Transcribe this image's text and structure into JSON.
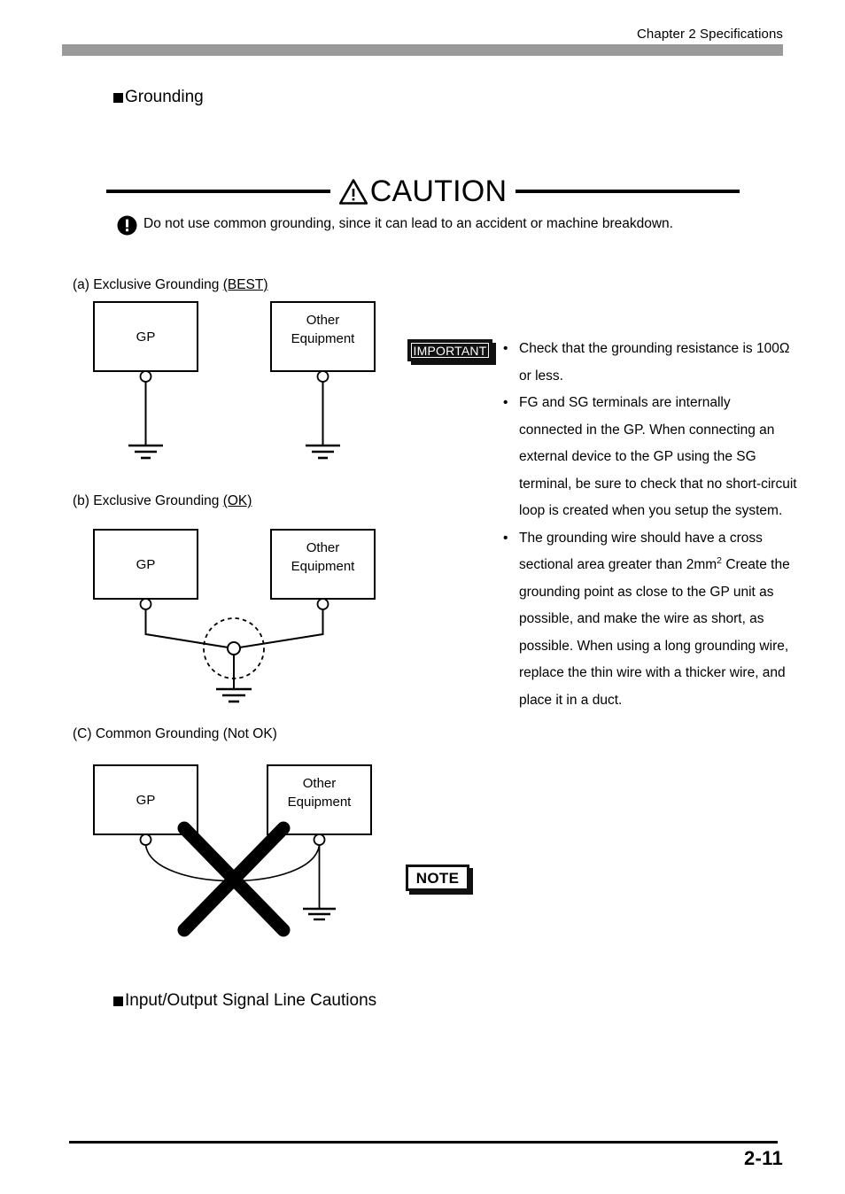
{
  "header": {
    "chapter_title": "Chapter 2 Specifications"
  },
  "sections": {
    "grounding_heading": "Grounding",
    "io_heading": "Input/Output Signal Line Cautions"
  },
  "caution": {
    "title": "CAUTION",
    "warning_icon": "warning-triangle-icon",
    "notice_icon": "exclamation-circle-icon",
    "text": "Do not use common grounding, since it can lead to an accident or machine breakdown."
  },
  "diagrams": [
    {
      "id": "a",
      "caption_prefix": "(a) Exclusive Grounding ",
      "caption_status": "(BEST)",
      "box_left_label": "GP",
      "box_right_label_line1": "Other",
      "box_right_label_line2": "Equipment"
    },
    {
      "id": "b",
      "caption_prefix": "(b) Exclusive Grounding ",
      "caption_status": "(OK)",
      "box_left_label": "GP",
      "box_right_label_line1": "Other",
      "box_right_label_line2": "Equipment"
    },
    {
      "id": "c",
      "caption_prefix": "(C) Common Grounding ",
      "caption_status": "(Not OK)",
      "box_left_label": "GP",
      "box_right_label_line1": "Other",
      "box_right_label_line2": "Equipment"
    }
  ],
  "important": {
    "badge_label": "IMPORTANT",
    "bullet_marker": "•",
    "items": [
      "Check that the grounding resistance is 100Ω or less.",
      "FG and SG terminals are internally connected in the GP. When connecting an external device to the GP using the SG terminal, be sure to check that no short-circuit loop is created when you setup the system.",
      "The grounding wire should have a cross sectional area greater than 2mm"
    ],
    "item3_superscript": "2",
    "item3_continuation": "Create the grounding point as close to the GP unit as possible, and make the wire as short, as possible. When using a long grounding wire, replace the thin wire with a thicker wire, and place it in a duct."
  },
  "note": {
    "badge_label": "NOTE"
  },
  "footer": {
    "page_number": "2-11"
  },
  "colors": {
    "header_bar": "#9a9a9a",
    "ink": "#000000",
    "badge_dark": "#111111",
    "page_background": "#ffffff"
  }
}
